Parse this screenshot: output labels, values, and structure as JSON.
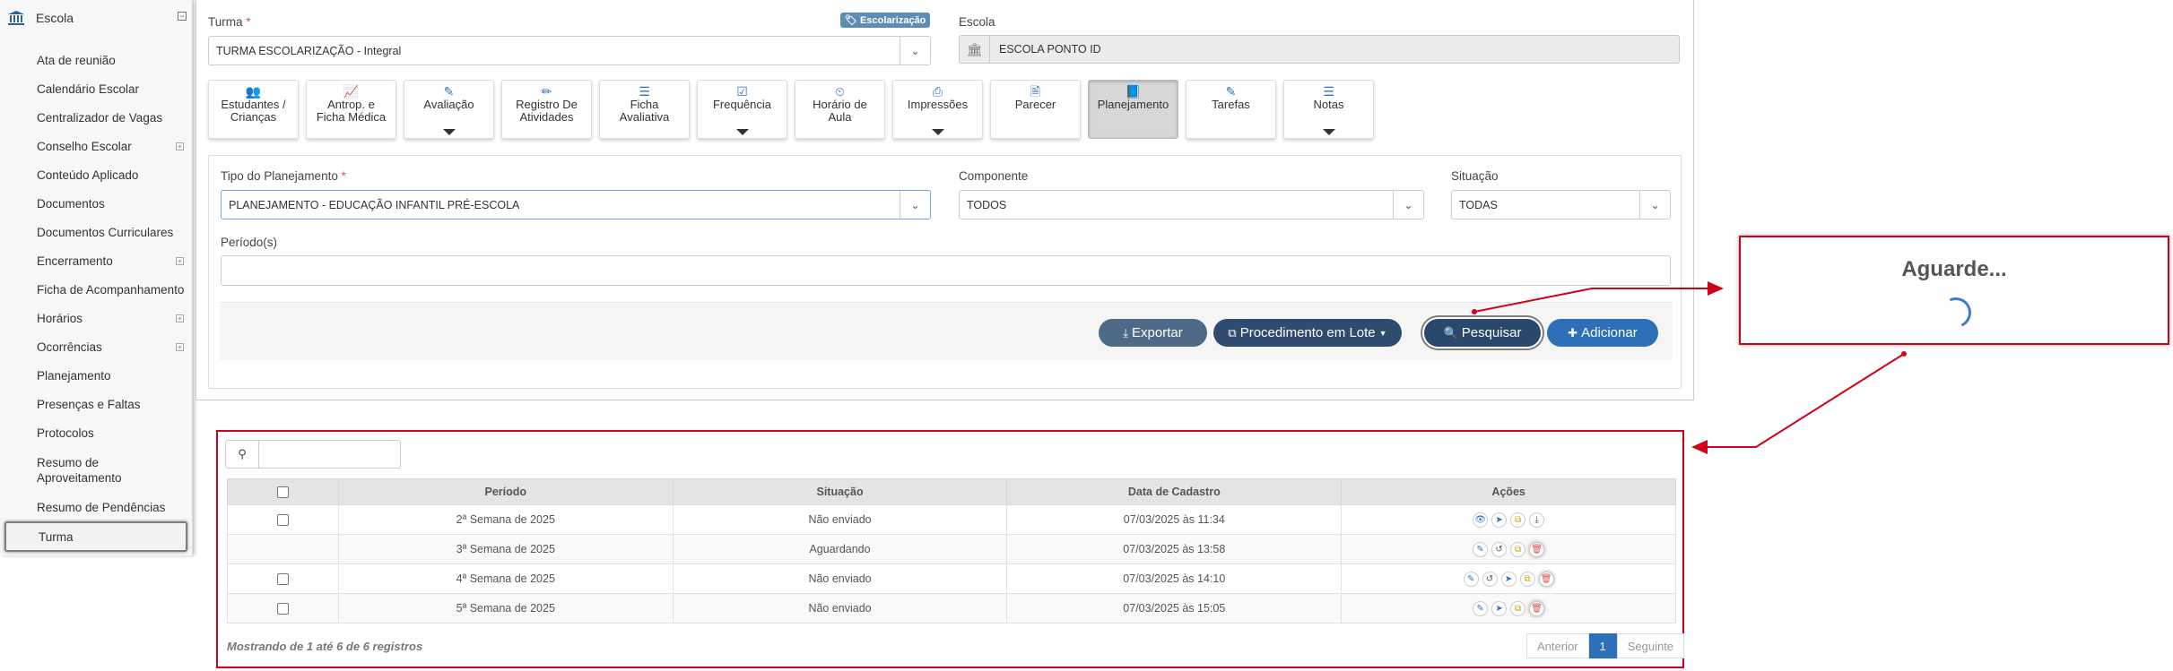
{
  "sidebar": {
    "header": {
      "label": "Escola",
      "collapse": "⊟"
    },
    "items": [
      {
        "label": "Ata de reunião"
      },
      {
        "label": "Calendário Escolar"
      },
      {
        "label": "Centralizador de Vagas"
      },
      {
        "label": "Conselho Escolar",
        "expand": "⊞"
      },
      {
        "label": "Conteúdo Aplicado"
      },
      {
        "label": "Documentos"
      },
      {
        "label": "Documentos Curriculares"
      },
      {
        "label": "Encerramento",
        "expand": "⊞"
      },
      {
        "label": "Ficha de Acompanhamento"
      },
      {
        "label": "Horários",
        "expand": "⊞"
      },
      {
        "label": "Ocorrências",
        "expand": "⊞"
      },
      {
        "label": "Planejamento"
      },
      {
        "label": "Presenças e Faltas"
      },
      {
        "label": "Protocolos"
      },
      {
        "label": "Resumo de Aproveitamento"
      },
      {
        "label": "Resumo de Pendências"
      },
      {
        "label": "Turma"
      }
    ]
  },
  "form": {
    "turma_label": "Turma",
    "required": "*",
    "turma_value": "TURMA ESCOLARIZAÇÃO - Integral",
    "badge": "Escolarização",
    "escola_label": "Escola",
    "escola_value": "ESCOLA PONTO ID",
    "tipo_label": "Tipo do Planejamento",
    "tipo_value": "PLANEJAMENTO - EDUCAÇÃO INFANTIL PRÉ-ESCOLA",
    "componente_label": "Componente",
    "componente_value": "TODOS",
    "situacao_label": "Situação",
    "situacao_value": "TODAS",
    "periodo_label": "Período(s)"
  },
  "tiles": [
    {
      "line1": "Estudantes /",
      "line2": "Crianças",
      "icon": "users-icon"
    },
    {
      "line1": "Antrop. e",
      "line2": "Ficha Médica",
      "icon": "chart-icon"
    },
    {
      "line1": "Avaliação",
      "line2": "",
      "icon": "edit-icon"
    },
    {
      "line1": "Registro De",
      "line2": "Atividades",
      "icon": "pencil-icon"
    },
    {
      "line1": "Ficha",
      "line2": "Avaliativa",
      "icon": "list-icon"
    },
    {
      "line1": "Frequência",
      "line2": "",
      "icon": "check-icon"
    },
    {
      "line1": "Horário de",
      "line2": "Aula",
      "icon": "clock-icon"
    },
    {
      "line1": "Impressões",
      "line2": "",
      "icon": "print-icon"
    },
    {
      "line1": "Parecer",
      "line2": "",
      "icon": "file-icon"
    },
    {
      "line1": "Planejamento",
      "line2": "",
      "icon": "book-icon"
    },
    {
      "line1": "Tarefas",
      "line2": "",
      "icon": "pencil-icon"
    },
    {
      "line1": "Notas",
      "line2": "",
      "icon": "list-icon"
    }
  ],
  "buttons": {
    "exportar": "Exportar",
    "procedimento": "Procedimento em Lote",
    "pesquisar": "Pesquisar",
    "adicionar": "Adicionar"
  },
  "modal": {
    "title": "Aguarde..."
  },
  "table": {
    "headers": [
      "Período",
      "Situação",
      "Data de Cadastro",
      "Ações"
    ],
    "rows": [
      {
        "periodo": "2ª Semana de 2025",
        "situacao": "Não enviado",
        "data": "07/03/2025 às 11:34",
        "checkbox": true
      },
      {
        "periodo": "3ª Semana de 2025",
        "situacao": "Aguardando",
        "data": "07/03/2025 às 13:58",
        "checkbox": false
      },
      {
        "periodo": "4ª Semana de 2025",
        "situacao": "Não enviado",
        "data": "07/03/2025 às 14:10",
        "checkbox": true
      },
      {
        "periodo": "5ª Semana de 2025",
        "situacao": "Não enviado",
        "data": "07/03/2025 às 15:05",
        "checkbox": true
      }
    ],
    "footer": "Mostrando de 1 até 6 de 6 registros",
    "pager": {
      "prev": "Anterior",
      "current": "1",
      "next": "Seguinte"
    }
  },
  "colors": {
    "annotation_red": "#d0021b",
    "primary": "#2d6fb8",
    "dark_button": "#2f4b70"
  }
}
